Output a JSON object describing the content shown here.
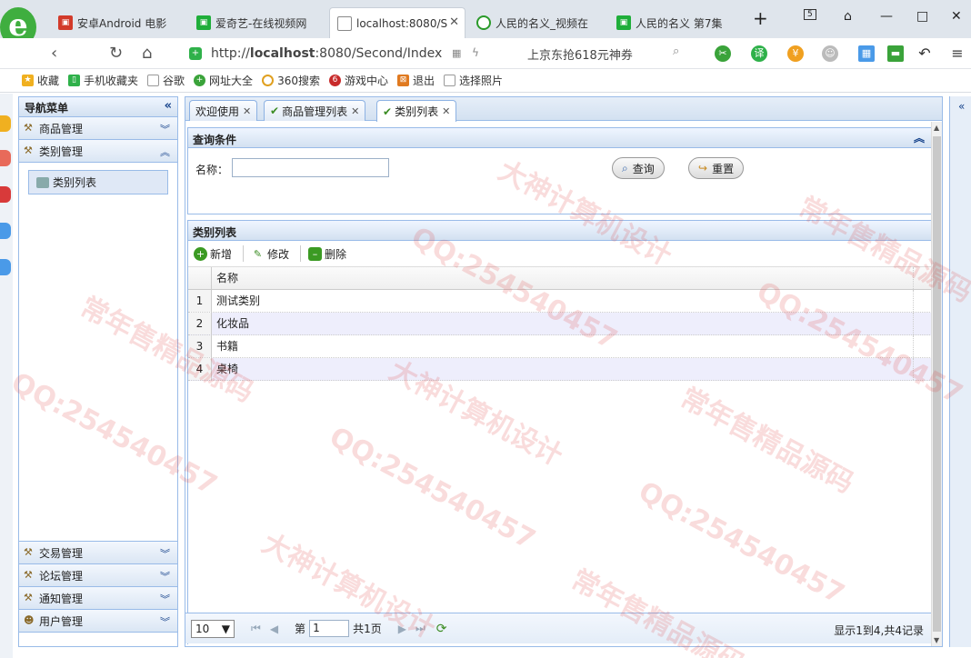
{
  "browser": {
    "tabs": [
      {
        "title": "安卓Android 电影",
        "fav": "red"
      },
      {
        "title": "爱奇艺-在线视频网",
        "fav": "green"
      },
      {
        "title": "localhost:8080/S",
        "fav": "doc"
      },
      {
        "title": "人民的名义_视频在",
        "fav": "circle"
      },
      {
        "title": "人民的名义 第7集",
        "fav": "green"
      }
    ],
    "tab_count_badge": "5",
    "url_prefix": "http://",
    "url_host": "localhost",
    "url_rest": ":8080/Second/Index",
    "search_text": "上京东抢618元神券",
    "bookmarks": [
      "收藏",
      "手机收藏夹",
      "谷歌",
      "网址大全",
      "360搜索",
      "游戏中心",
      "退出",
      "选择照片"
    ]
  },
  "sidebar": {
    "title": "导航菜单",
    "groups": [
      {
        "label": "商品管理"
      },
      {
        "label": "类别管理"
      },
      {
        "label": "交易管理"
      },
      {
        "label": "论坛管理"
      },
      {
        "label": "通知管理"
      },
      {
        "label": "用户管理"
      }
    ],
    "expanded_item": "类别列表"
  },
  "main": {
    "tabs": [
      {
        "label": "欢迎使用"
      },
      {
        "label": "商品管理列表"
      },
      {
        "label": "类别列表"
      }
    ],
    "query": {
      "title": "查询条件",
      "name_label": "名称：",
      "name_value": "",
      "search_label": "查询",
      "reset_label": "重置"
    },
    "list": {
      "title": "类别列表",
      "toolbar": {
        "add": "新增",
        "edit": "修改",
        "delete": "删除"
      },
      "column": "名称",
      "rows": [
        {
          "n": "1",
          "name": "测试类别"
        },
        {
          "n": "2",
          "name": "化妆品"
        },
        {
          "n": "3",
          "name": "书籍"
        },
        {
          "n": "4",
          "name": "桌椅"
        }
      ]
    },
    "pager": {
      "page_size": "10",
      "page_prefix": "第",
      "page_value": "1",
      "page_total": "共1页",
      "info": "显示1到4,共4记录"
    }
  },
  "watermark": {
    "texts": [
      "QQ:254540457",
      "大神计算机设计",
      "常年售精品源码"
    ],
    "color": "#dc3c3c"
  }
}
